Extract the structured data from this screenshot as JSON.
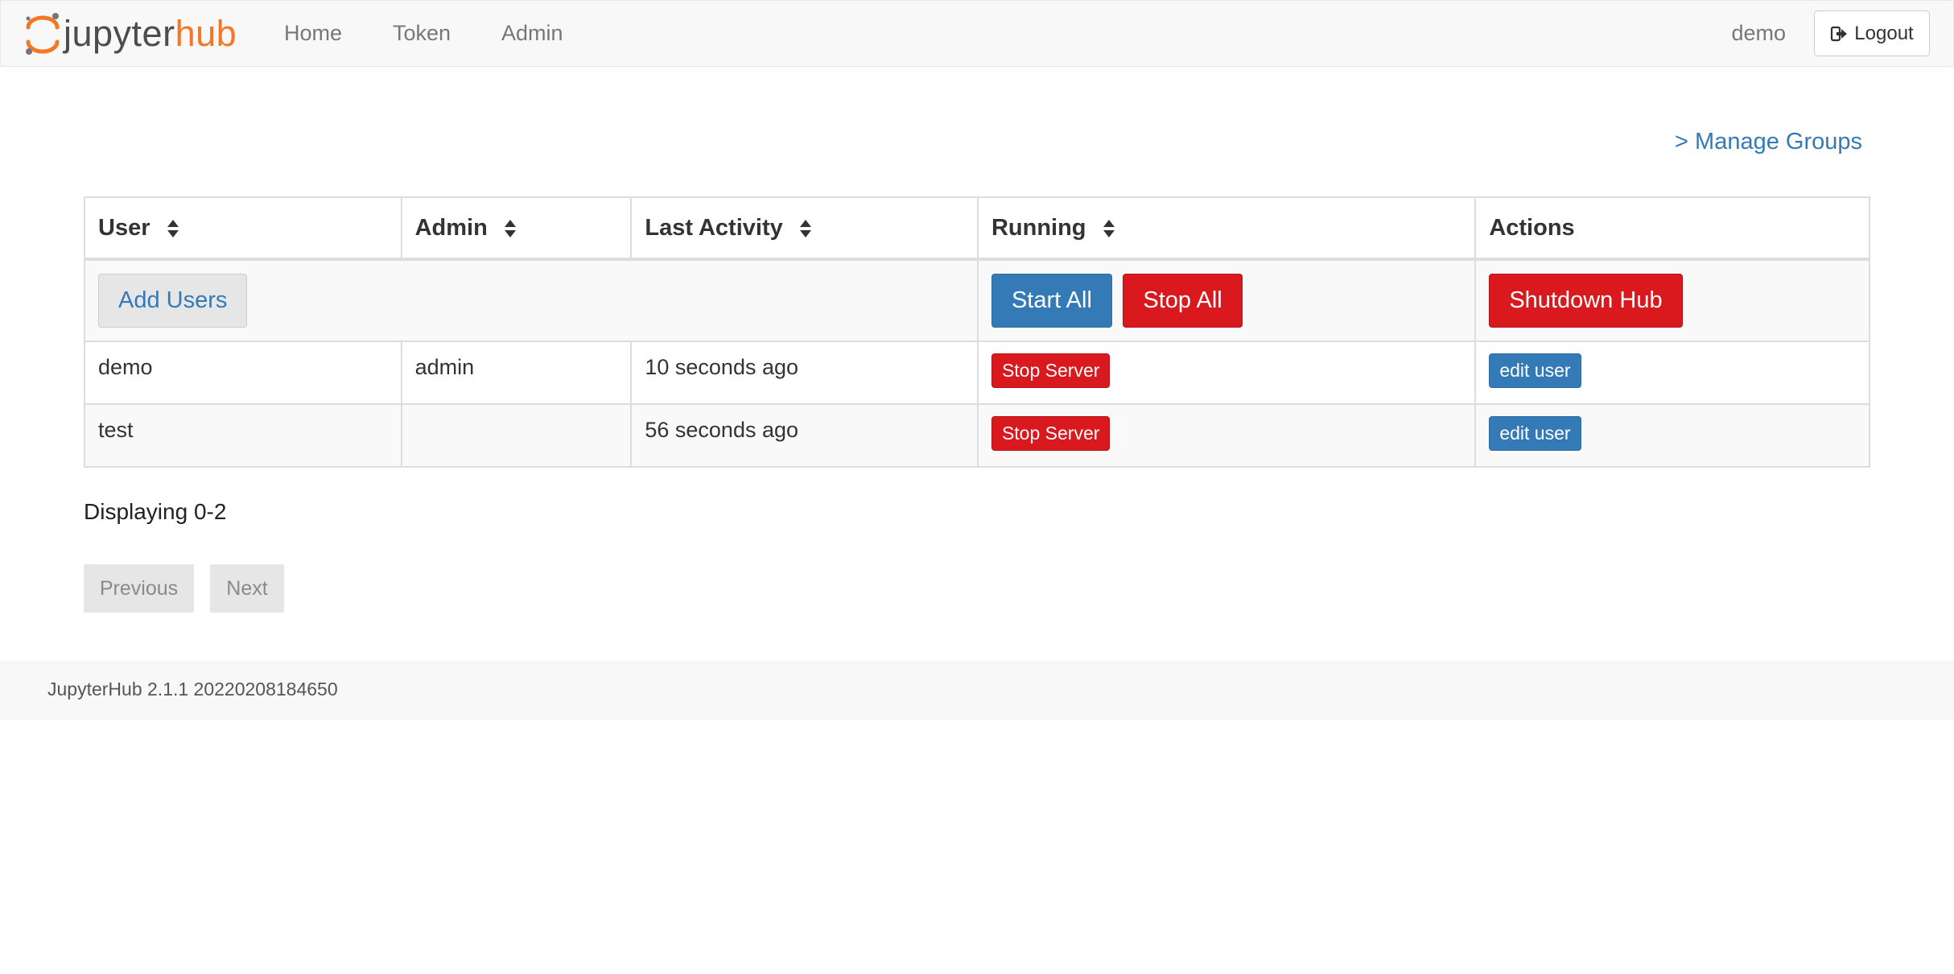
{
  "navbar": {
    "brand": {
      "jupyter": "jupyter",
      "hub": "hub"
    },
    "links": {
      "home": "Home",
      "token": "Token",
      "admin": "Admin"
    },
    "username": "demo",
    "logout_label": "Logout"
  },
  "manage_groups": "> Manage Groups",
  "table": {
    "headers": {
      "user": "User",
      "admin": "Admin",
      "last_activity": "Last Activity",
      "running": "Running",
      "actions": "Actions"
    },
    "controls": {
      "add_users": "Add Users",
      "start_all": "Start All",
      "stop_all": "Stop All",
      "shutdown_hub": "Shutdown Hub"
    },
    "rows": [
      {
        "user": "demo",
        "admin": "admin",
        "last_activity": "10 seconds ago",
        "server_action": "Stop Server",
        "edit": "edit user"
      },
      {
        "user": "test",
        "admin": "",
        "last_activity": "56 seconds ago",
        "server_action": "Stop Server",
        "edit": "edit user"
      }
    ]
  },
  "pagination": {
    "displaying": "Displaying 0-2",
    "previous": "Previous",
    "next": "Next"
  },
  "footer": {
    "version": "JupyterHub 2.1.1 20220208184650"
  },
  "colors": {
    "brand_orange": "#f37726",
    "primary": "#337ab7",
    "danger": "#d9191d"
  }
}
